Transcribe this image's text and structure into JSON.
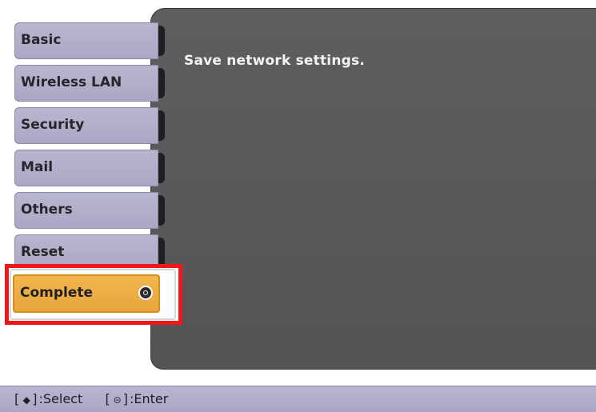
{
  "panel": {
    "message": "Save network settings."
  },
  "menu": {
    "items": [
      {
        "label": "Basic"
      },
      {
        "label": "Wireless LAN"
      },
      {
        "label": "Security"
      },
      {
        "label": "Mail"
      },
      {
        "label": "Others"
      },
      {
        "label": "Reset"
      }
    ],
    "selected": {
      "label": "Complete"
    }
  },
  "hint": {
    "select_key": "[",
    "select_icon": "◆",
    "select_key_close": "]",
    "select_text": ":Select",
    "enter_key": "[",
    "enter_icon": "⊝",
    "enter_key_close": "]",
    "enter_text": ":Enter"
  },
  "colors": {
    "panel": "#585859",
    "menu_bg": "#b1afc9",
    "selected_bg": "#eead48",
    "highlight_outline": "#ef1717"
  },
  "icons": {
    "complete": "enter-circle-icon",
    "select": "select-diamond-icon",
    "enter": "enter-circle-icon"
  }
}
